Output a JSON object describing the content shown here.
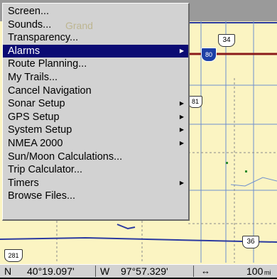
{
  "menu": {
    "items": [
      {
        "label": "Screen...",
        "has_submenu": false,
        "selected": false
      },
      {
        "label": "Sounds...",
        "has_submenu": false,
        "selected": false
      },
      {
        "label": "Transparency...",
        "has_submenu": false,
        "selected": false
      },
      {
        "label": "Alarms",
        "has_submenu": true,
        "selected": true
      },
      {
        "label": "Route Planning...",
        "has_submenu": false,
        "selected": false
      },
      {
        "label": "My Trails...",
        "has_submenu": false,
        "selected": false
      },
      {
        "label": "Cancel Navigation",
        "has_submenu": false,
        "selected": false
      },
      {
        "label": "Sonar Setup",
        "has_submenu": true,
        "selected": false
      },
      {
        "label": "GPS Setup",
        "has_submenu": true,
        "selected": false
      },
      {
        "label": "System Setup",
        "has_submenu": true,
        "selected": false
      },
      {
        "label": "NMEA 2000",
        "has_submenu": true,
        "selected": false
      },
      {
        "label": "Sun/Moon Calculations...",
        "has_submenu": false,
        "selected": false
      },
      {
        "label": "Trip Calculator...",
        "has_submenu": false,
        "selected": false
      },
      {
        "label": "Timers",
        "has_submenu": true,
        "selected": false
      },
      {
        "label": "Browse Files...",
        "has_submenu": false,
        "selected": false
      }
    ]
  },
  "map": {
    "highway_shields": [
      "34",
      "80",
      "81",
      "36",
      "281"
    ],
    "ghost_label": "Grand",
    "colors": {
      "land": "#fbf4c2",
      "interstate": "#8b1a1a",
      "highway_shield": "#ffffff",
      "interstate_shield": "#1d3fa6"
    }
  },
  "status": {
    "lat_hemisphere": "N",
    "latitude": "40°19.097'",
    "lon_hemisphere": "W",
    "longitude": "97°57.329'",
    "zoom_icon": "horizontal-arrows-icon",
    "zoom_value": "100",
    "zoom_unit": "mi"
  },
  "colors": {
    "menu_bg": "#d2d2d2",
    "selection": "#0b0b73"
  }
}
